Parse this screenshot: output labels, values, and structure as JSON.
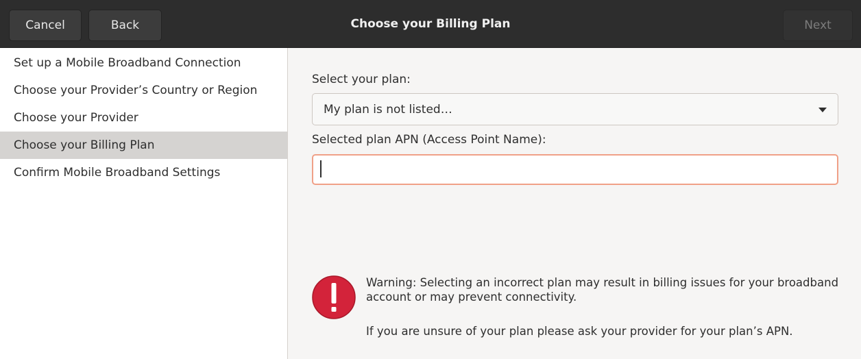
{
  "header": {
    "title": "Choose your Billing Plan",
    "cancel_label": "Cancel",
    "back_label": "Back",
    "next_label": "Next"
  },
  "sidebar": {
    "items": [
      {
        "label": "Set up a Mobile Broadband Connection",
        "active": false
      },
      {
        "label": "Choose your Provider’s Country or Region",
        "active": false
      },
      {
        "label": "Choose your Provider",
        "active": false
      },
      {
        "label": "Choose your Billing Plan",
        "active": true
      },
      {
        "label": "Confirm Mobile Broadband Settings",
        "active": false
      }
    ]
  },
  "form": {
    "plan_label": "Select your plan:",
    "plan_selected": "My plan is not listed…",
    "apn_label": "Selected plan APN (Access Point Name):",
    "apn_value": ""
  },
  "warning": {
    "icon": "warning-icon",
    "text": "Warning: Selecting an incorrect plan may result in billing issues for your broadband account or may prevent connectivity.",
    "hint": "If you are unsure of your plan please ask your provider for your plan’s APN."
  },
  "colors": {
    "headerbar": "#2d2d2d",
    "active_row": "#d5d3d1",
    "entry_focus_border": "#f0a087",
    "warning_red": "#d3233a"
  }
}
